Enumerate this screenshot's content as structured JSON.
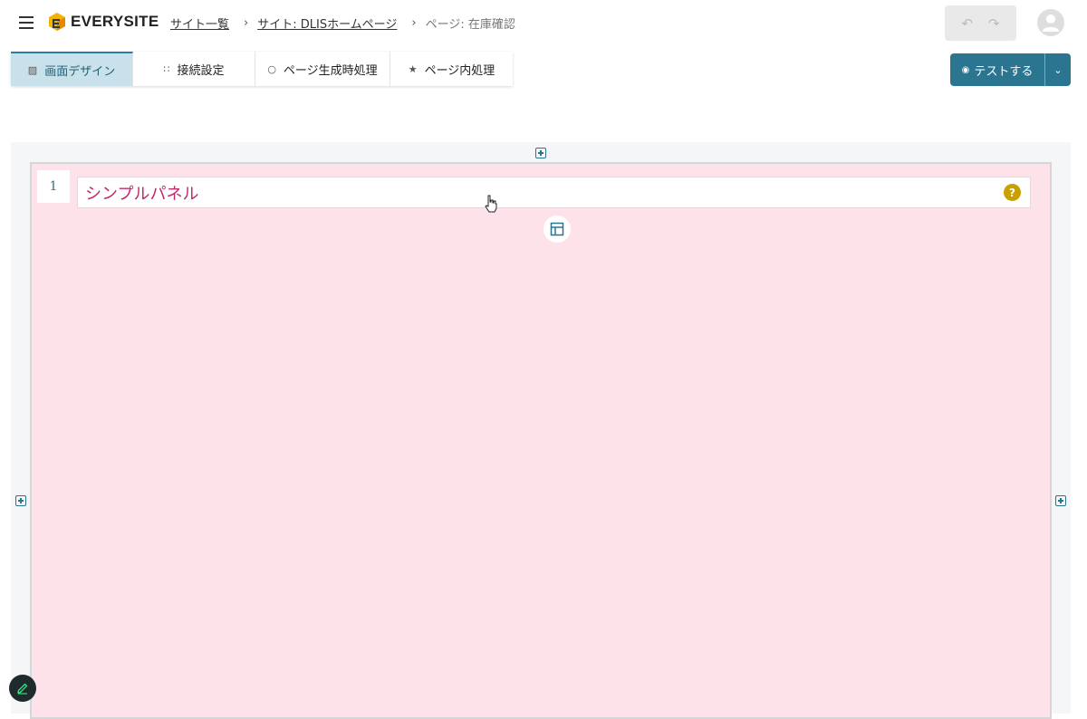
{
  "header": {
    "logo_text": "EVERYSITE",
    "breadcrumb": {
      "item1": "サイト一覧",
      "item2": "サイト: DLISホームページ",
      "current": "ページ: 在庫確認"
    },
    "undo_icon": "undo-icon",
    "redo_icon": "redo-icon"
  },
  "tabs": [
    {
      "label": "画面デザイン",
      "icon": "layout-icon"
    },
    {
      "label": "接続設定",
      "icon": "connection-icon"
    },
    {
      "label": "ページ生成時処理",
      "icon": "refresh-icon"
    },
    {
      "label": "ページ内処理",
      "icon": "run-icon"
    }
  ],
  "test_button": {
    "label": "テストする",
    "icon": "eye-icon"
  },
  "panel": {
    "number": "1",
    "title": "シンプルパネル",
    "help": "?"
  },
  "colors": {
    "accent": "#2b7590",
    "panel_bg": "#fde2ea",
    "panel_title": "#c2286a",
    "help": "#c9a000"
  }
}
